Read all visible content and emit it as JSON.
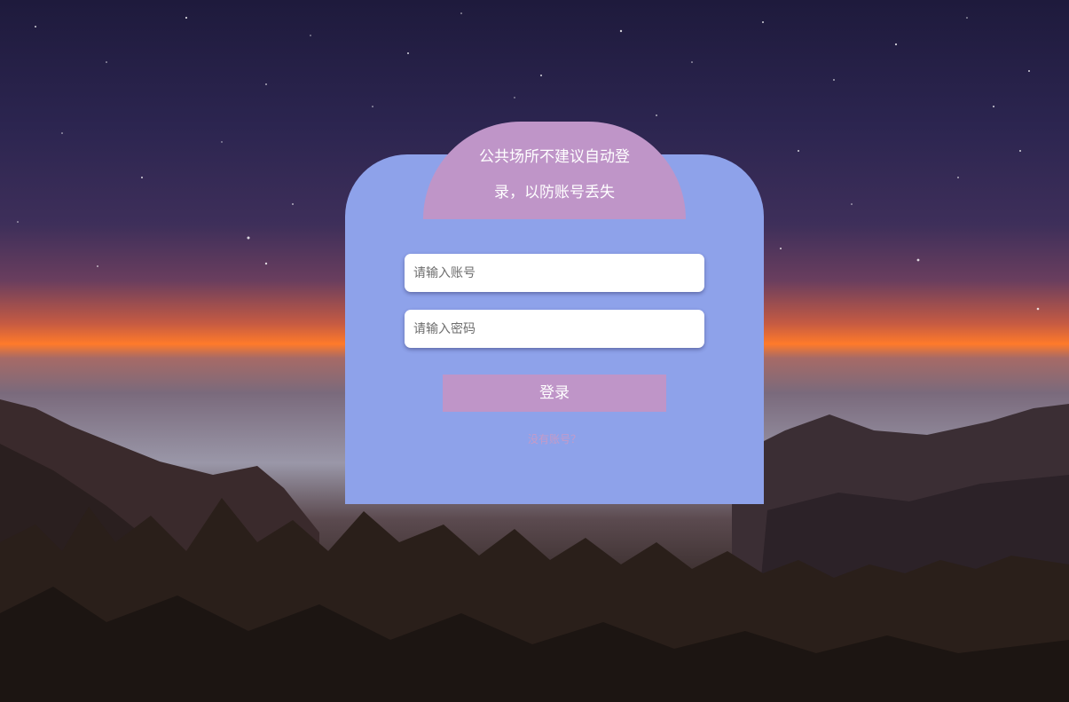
{
  "login": {
    "tip_line1": "公共场所不建议自动登",
    "tip_line2": "录，以防账号丢失",
    "account_placeholder": "请输入账号",
    "password_placeholder": "请输入密码",
    "login_button": "登录",
    "register_link": "没有账号？"
  },
  "colors": {
    "card": "#8ea2ea",
    "accent": "#bf95c8",
    "button_text": "#ffffff"
  }
}
